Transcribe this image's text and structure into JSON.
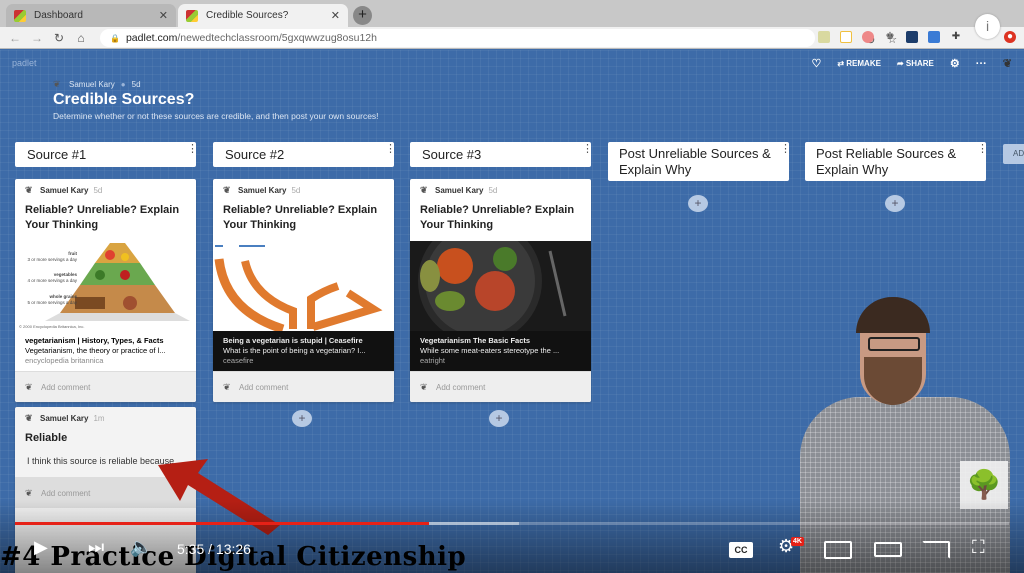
{
  "browser": {
    "tabs": [
      {
        "title": "Dashboard",
        "active": false
      },
      {
        "title": "Credible Sources?",
        "active": true
      }
    ],
    "url_host": "padlet.com",
    "url_path": "/newedtechclassroom/5gxqwwzug8osu12h"
  },
  "padlet": {
    "brand": "padlet",
    "toolbar": {
      "remake": "REMAKE",
      "share": "SHARE"
    },
    "author": "Samuel Kary",
    "age": "5d",
    "title": "Credible Sources?",
    "description": "Determine whether or not these sources are credible, and then post your own sources!",
    "add_column_label": "AD",
    "columns": [
      {
        "title": "Source #1"
      },
      {
        "title": "Source #2"
      },
      {
        "title": "Source #3"
      },
      {
        "title": "Post Unreliable Sources & Explain Why"
      },
      {
        "title": "Post Reliable Sources & Explain Why"
      }
    ],
    "cards": [
      {
        "author": "Samuel Kary",
        "age": "5d",
        "subject": "Reliable? Unreliable? Explain Your Thinking",
        "link_title": "vegetarianism | History, Types, & Facts",
        "link_desc": "Vegetarianism, the theory or practice of l...",
        "link_source": "encyclopedia britannica",
        "image_caption": "© 2000 Encyclopedia Britannica, Inc.",
        "pyramid_labels": [
          "fruit",
          "3 or more servings a day",
          "vegetables",
          "4 or more servings a day",
          "whole grains",
          "5 or more servings a day"
        ]
      },
      {
        "author": "Samuel Kary",
        "age": "5d",
        "subject": "Reliable? Unreliable? Explain Your Thinking",
        "link_title": "Being a vegetarian is stupid | Ceasefire",
        "link_desc": "What is the point of being a vegetarian? I...",
        "link_source": "ceasefire"
      },
      {
        "author": "Samuel Kary",
        "age": "5d",
        "subject": "Reliable? Unreliable? Explain Your Thinking",
        "link_title": "Vegetarianism The Basic Facts",
        "link_desc": "While some meat-eaters stereotype the ...",
        "link_source": "eatright"
      },
      {
        "author": "Samuel Kary",
        "age": "1m",
        "subject": "Reliable",
        "body": "I think this source is reliable because..."
      }
    ],
    "add_comment": "Add comment"
  },
  "video": {
    "current_time": "5:35",
    "duration": "13:26",
    "time_display": "5:35 / 13:26",
    "played_fraction": 0.416,
    "buffered_fraction": 0.507,
    "quality_badge": "4K",
    "cc_label": "CC",
    "overlay_title": "#4 Practice Digital Citizenship"
  },
  "colors": {
    "background": "#3d6ba8",
    "progress_played": "#e62117",
    "arrow": "#b51f14",
    "ceasefire_orange": "#e07a2e"
  }
}
